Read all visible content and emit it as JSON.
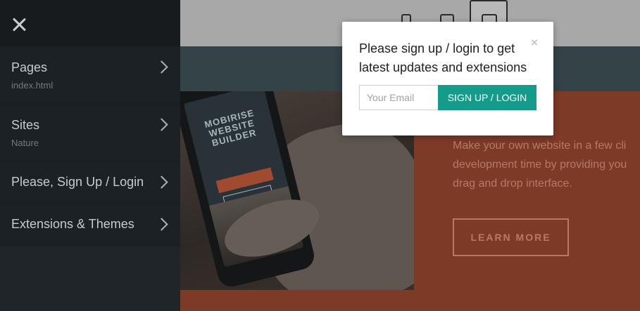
{
  "sidebar": {
    "items": [
      {
        "label": "Pages",
        "sub": "index.html"
      },
      {
        "label": "Sites",
        "sub": "Nature"
      },
      {
        "label": "Please, Sign Up / Login"
      },
      {
        "label": "Extensions & Themes"
      }
    ]
  },
  "hero": {
    "description_lines": [
      "Make your own website in a few cli",
      "development time by providing you",
      "drag and drop interface."
    ],
    "learn_more_label": "LEARN MORE",
    "phone_title": "MOBIRISE WEBSITE BUILDER"
  },
  "modal": {
    "title": "Please sign up / login to get latest updates and extensions",
    "close_glyph": "×",
    "email_placeholder": "Your Email",
    "signup_label": "SIGN UP / LOGIN"
  },
  "colors": {
    "accent": "#149b8a",
    "sidebar_bg": "#1f2528",
    "hero_orange": "#7d3a27"
  }
}
